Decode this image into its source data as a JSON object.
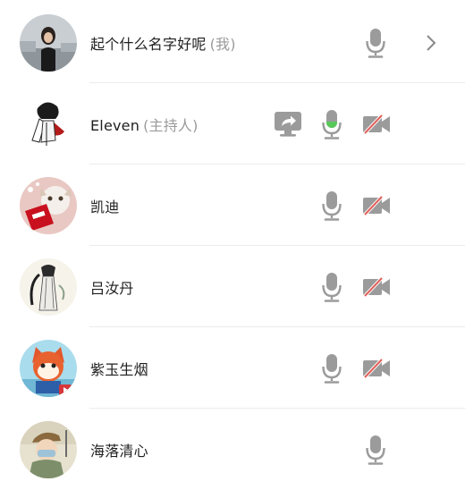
{
  "participants": [
    {
      "name": "起个什么名字好呢",
      "tag": "(我)",
      "mic": "mic-idle",
      "camera": null,
      "share": null,
      "chevron": true
    },
    {
      "name": "Eleven",
      "tag": "(主持人)",
      "mic": "mic-active",
      "camera": "camera-off",
      "share": "screen-share",
      "chevron": false
    },
    {
      "name": "凯迪",
      "tag": "",
      "mic": "mic-idle",
      "camera": "camera-off",
      "share": null,
      "chevron": false
    },
    {
      "name": "吕汝丹",
      "tag": "",
      "mic": "mic-idle",
      "camera": "camera-off",
      "share": null,
      "chevron": false
    },
    {
      "name": "紫玉生烟",
      "tag": "",
      "mic": "mic-idle",
      "camera": "camera-off",
      "share": null,
      "chevron": false
    },
    {
      "name": "海落清心",
      "tag": "",
      "mic": "mic-idle",
      "camera": null,
      "share": null,
      "chevron": false
    }
  ],
  "colors": {
    "icon_gray": "#9b9b9b",
    "mic_active": "#59c85a",
    "camera_off_slash": "#e0605a",
    "divider": "#ececec"
  }
}
